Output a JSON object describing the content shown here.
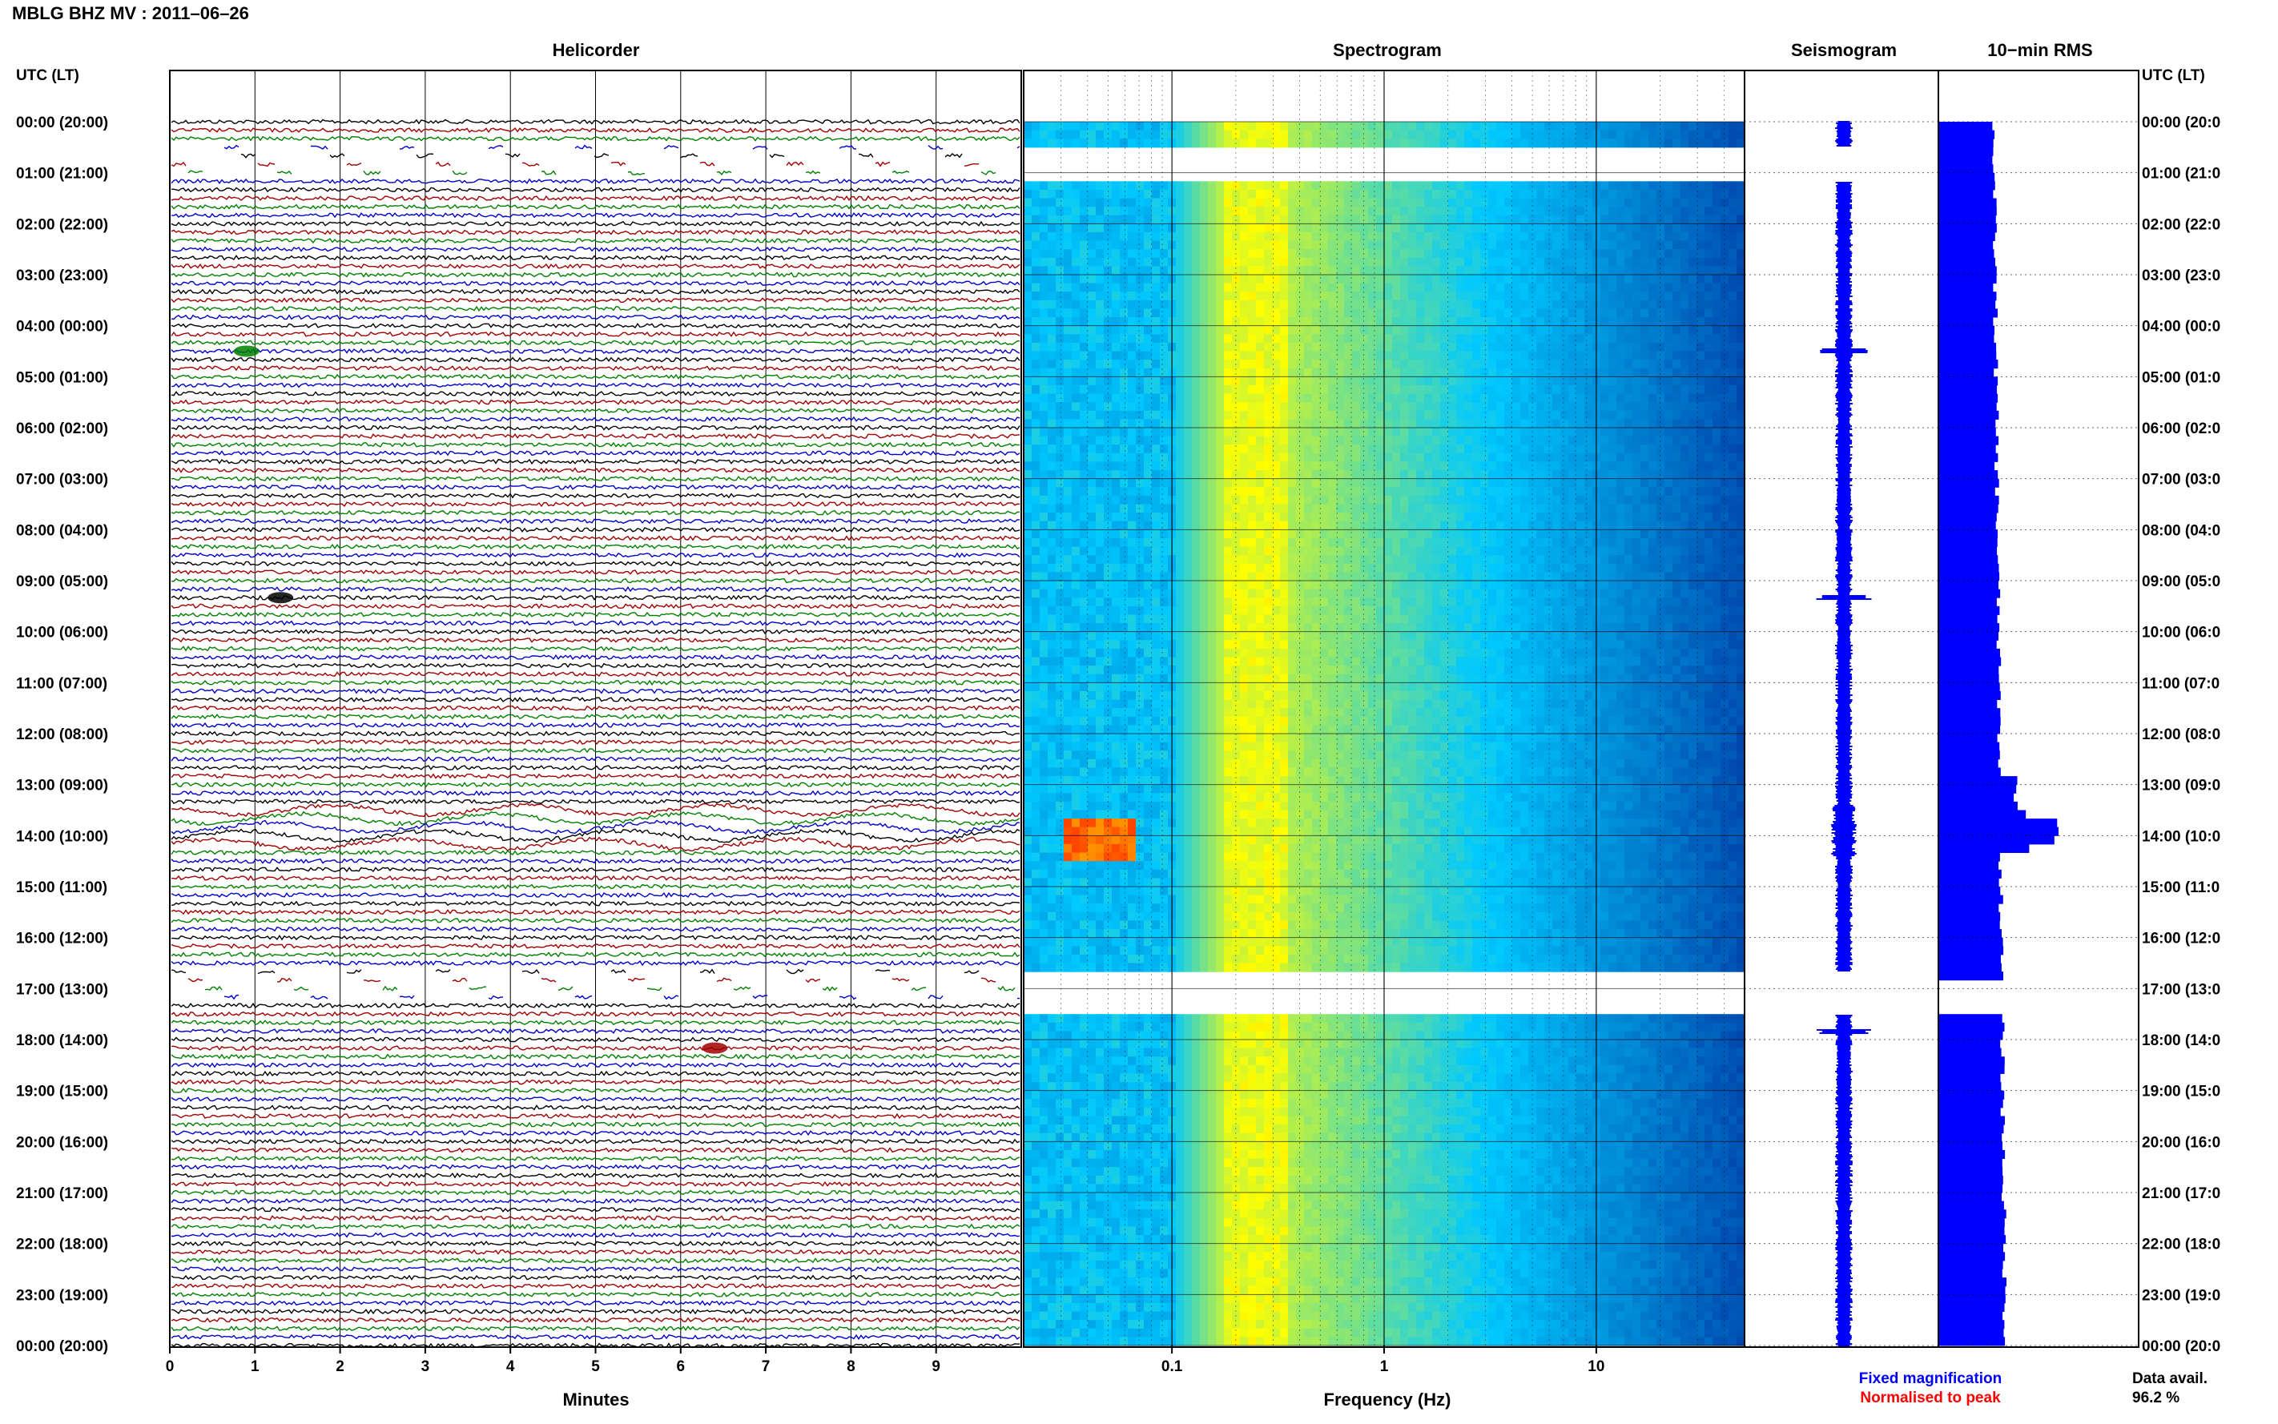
{
  "page": {
    "title": "MBLG BHZ MV : 2011–06–26",
    "left_axis_header": "UTC (LT)",
    "right_axis_header": "UTC (LT)"
  },
  "panels": {
    "helicorder": "Helicorder",
    "spectrogram": "Spectrogram",
    "seismogram": "Seismogram",
    "rms": "10−min RMS"
  },
  "hour_labels_left": [
    "00:00 (20:00)",
    "01:00 (21:00)",
    "02:00 (22:00)",
    "03:00 (23:00)",
    "04:00 (00:00)",
    "05:00 (01:00)",
    "06:00 (02:00)",
    "07:00 (03:00)",
    "08:00 (04:00)",
    "09:00 (05:00)",
    "10:00 (06:00)",
    "11:00 (07:00)",
    "12:00 (08:00)",
    "13:00 (09:00)",
    "14:00 (10:00)",
    "15:00 (11:00)",
    "16:00 (12:00)",
    "17:00 (13:00)",
    "18:00 (14:00)",
    "19:00 (15:00)",
    "20:00 (16:00)",
    "21:00 (17:00)",
    "22:00 (18:00)",
    "23:00 (19:00)",
    "00:00 (20:00)"
  ],
  "hour_labels_right": [
    "00:00 (20:0",
    "01:00 (21:0",
    "02:00 (22:0",
    "03:00 (23:0",
    "04:00 (00:0",
    "05:00 (01:0",
    "06:00 (02:0",
    "07:00 (03:0",
    "08:00 (04:0",
    "09:00 (05:0",
    "10:00 (06:0",
    "11:00 (07:0",
    "12:00 (08:0",
    "13:00 (09:0",
    "14:00 (10:0",
    "15:00 (11:0",
    "16:00 (12:0",
    "17:00 (13:0",
    "18:00 (14:0",
    "19:00 (15:0",
    "20:00 (16:0",
    "21:00 (17:0",
    "22:00 (18:0",
    "23:00 (19:0",
    "00:00 (20:0"
  ],
  "legend": {
    "fixed": "Fixed magnification",
    "normalised": "Normalised to peak",
    "data_avail_label": "Data avail.",
    "data_avail_value": "96.2 %"
  },
  "colors": {
    "trace_cycle": [
      "#000000",
      "#a00000",
      "#008000",
      "#0000c8"
    ],
    "seismogram": "#0000ff",
    "rms": "#0000ff",
    "fixed_legend": "#0000ff",
    "normalised_legend": "#ff0000",
    "spectrogram_low": "#00007f",
    "spectrogram_mid": "#00c8ff",
    "spectrogram_high": "#ffff00",
    "spectrogram_peak": "#ff4000"
  },
  "chart_data": [
    {
      "type": "line",
      "subtype": "helicorder",
      "title": "Helicorder",
      "xlabel": "Minutes",
      "x_ticks": [
        "0",
        "1",
        "2",
        "3",
        "4",
        "5",
        "6",
        "7",
        "8",
        "9"
      ],
      "xlim": [
        0,
        10
      ],
      "lines_per_hour": 6,
      "total_lines": 144,
      "gaps": [
        {
          "from_utc": "00:30",
          "to_utc": "01:10",
          "note": "partial data"
        },
        {
          "from_utc": "16:40",
          "to_utc": "17:20",
          "note": "partial data"
        }
      ],
      "events": [
        {
          "utc": "04:30",
          "minute": 0.9,
          "color": "green"
        },
        {
          "utc": "09:20",
          "minute": 1.3,
          "color": "black"
        },
        {
          "utc": "13:30",
          "to_utc": "14:20",
          "note": "long-period swell"
        },
        {
          "utc": "18:10",
          "minute": 6.4,
          "color": "red"
        }
      ]
    },
    {
      "type": "heatmap",
      "subtype": "spectrogram",
      "title": "Spectrogram",
      "xlabel": "Frequency (Hz)",
      "x_scale": "log",
      "xlim": [
        0.02,
        50
      ],
      "x_ticks": [
        "0.1",
        "1",
        "10"
      ],
      "peak_band_hz": [
        0.17,
        0.35
      ],
      "event_utc": "14:00",
      "gaps_utc": [
        [
          "00:30",
          "01:10"
        ],
        [
          "16:40",
          "17:30"
        ]
      ]
    },
    {
      "type": "line",
      "subtype": "seismogram",
      "title": "Seismogram",
      "spikes_utc": [
        "04:30",
        "09:20",
        "17:50"
      ]
    },
    {
      "type": "bar",
      "subtype": "rms",
      "title": "10−min RMS",
      "interval_minutes": 10,
      "peak_utc": "13:50"
    }
  ]
}
